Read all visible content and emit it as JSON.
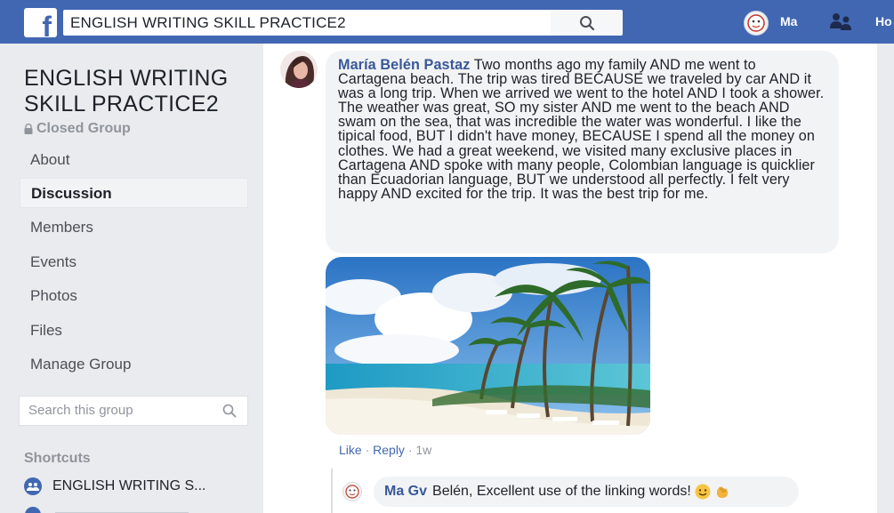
{
  "topbar": {
    "search_value": "ENGLISH WRITING SKILL PRACTICE2",
    "profile_name": "Ma",
    "home_label": "Ho",
    "brand_color": "#4267b2"
  },
  "sidebar": {
    "group_name": "ENGLISH WRITING SKILL PRACTICE2",
    "privacy": "Closed Group",
    "items": [
      {
        "label": "About",
        "active": false
      },
      {
        "label": "Discussion",
        "active": true
      },
      {
        "label": "Members",
        "active": false
      },
      {
        "label": "Events",
        "active": false
      },
      {
        "label": "Photos",
        "active": false
      },
      {
        "label": "Files",
        "active": false
      },
      {
        "label": "Manage Group",
        "active": false
      }
    ],
    "search_placeholder": "Search this group",
    "shortcuts_heading": "Shortcuts",
    "shortcut_label": "ENGLISH WRITING S..."
  },
  "post": {
    "author": "María Belén Pastaz",
    "text": "Two months ago my family AND me went to Cartagena beach. The trip was tired BECAUSE we traveled by car AND it was a long trip. When we arrived we went to the hotel AND I took a shower. The weather was great, SO my sister AND me went to the beach AND swam on the sea, that was incredible the water was wonderful. I like the tipical food, BUT I didn't have money, BECAUSE I spend all the money on clothes. We had a great weekend, we visited many exclusive places in Cartagena AND spoke with many people, Colombian language is quicklier than Ecuadorian language, BUT we understood all perfectly. I felt very happy AND excited for the trip. It was the best trip for me.",
    "like_label": "Like",
    "reply_label": "Reply",
    "time": "1w"
  },
  "reply": {
    "author": "Ma Gv",
    "text": "Belén, Excellent use of the linking words!"
  },
  "icons": {
    "logo": "facebook-logo-icon",
    "search": "search-icon",
    "friends": "friend-requests-icon",
    "lock": "lock-icon",
    "shortcut": "group-icon",
    "emoji1": "smiling-face-icon",
    "emoji2": "clapping-hands-icon"
  }
}
